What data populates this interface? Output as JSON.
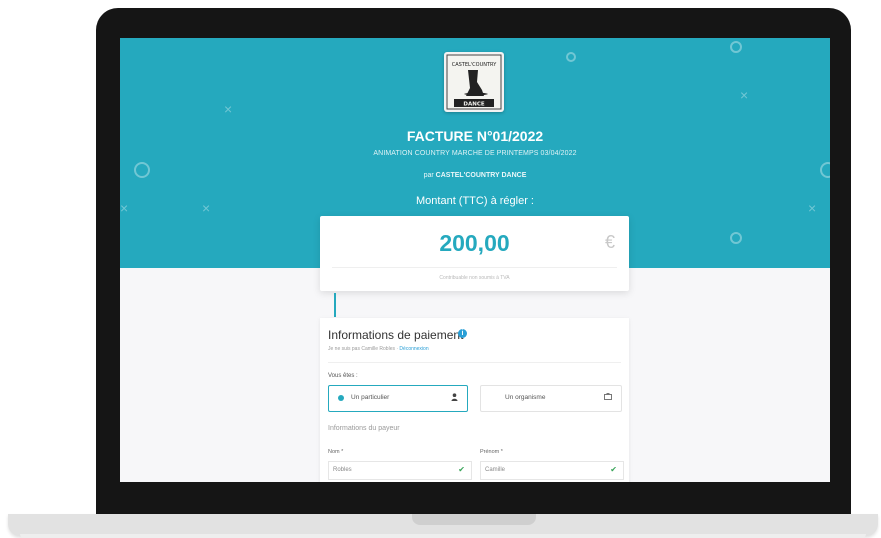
{
  "invoice": {
    "title": "FACTURE N°01/2022",
    "subtitle": "ANIMATION COUNTRY MARCHE DE PRINTEMPS 03/04/2022",
    "by_prefix": "par",
    "organization": "CASTEL'COUNTRY DANCE",
    "amount_label": "Montant (TTC) à régler :",
    "amount": "200,00",
    "currency_symbol": "€",
    "amount_note": "Contribuable non soumis à TVA"
  },
  "logo": {
    "top_text": "CASTEL'COUNTRY",
    "bottom_text": "DANCE"
  },
  "payment": {
    "section_title": "Informations de paiement",
    "not_me_text": "Je ne suis pas Camille Robles ·",
    "logout_link": "Déconnexion",
    "you_are_label": "Vous êtes :",
    "options": [
      {
        "label": "Un particulier",
        "icon": "user-icon",
        "selected": true
      },
      {
        "label": "Un organisme",
        "icon": "building-icon",
        "selected": false
      }
    ],
    "payer_section": "Informations du payeur",
    "fields": {
      "last_name": {
        "label": "Nom *",
        "value": "Robles"
      },
      "first_name": {
        "label": "Prénom *",
        "value": "Camille"
      }
    }
  },
  "colors": {
    "accent": "#25a9be",
    "link": "#2a9fd6",
    "valid": "#3aa55a"
  }
}
